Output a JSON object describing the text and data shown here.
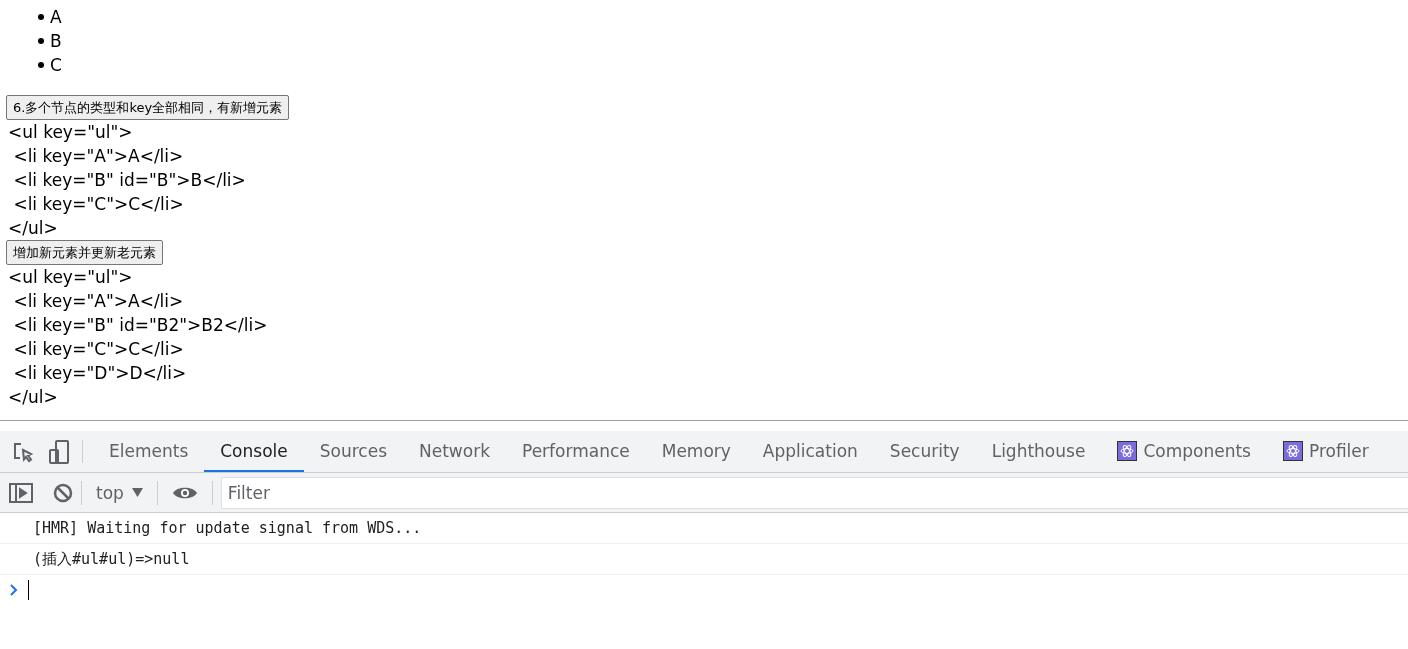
{
  "page": {
    "list": [
      "A",
      "B",
      "C"
    ],
    "sections": [
      {
        "button": "6.多个节点的类型和key全部相同，有新增元素",
        "code": [
          "<ul key=\"ul\">",
          " <li key=\"A\">A</li>",
          " <li key=\"B\" id=\"B\">B</li>",
          " <li key=\"C\">C</li>",
          "</ul>"
        ]
      },
      {
        "button": "增加新元素并更新老元素",
        "code": [
          "<ul key=\"ul\">",
          " <li key=\"A\">A</li>",
          " <li key=\"B\" id=\"B2\">B2</li>",
          " <li key=\"C\">C</li>",
          " <li key=\"D\">D</li>",
          "</ul>"
        ]
      }
    ]
  },
  "devtools": {
    "tabs": [
      {
        "label": "Elements",
        "selected": false,
        "kind": "builtin"
      },
      {
        "label": "Console",
        "selected": true,
        "kind": "builtin"
      },
      {
        "label": "Sources",
        "selected": false,
        "kind": "builtin"
      },
      {
        "label": "Network",
        "selected": false,
        "kind": "builtin"
      },
      {
        "label": "Performance",
        "selected": false,
        "kind": "builtin"
      },
      {
        "label": "Memory",
        "selected": false,
        "kind": "builtin"
      },
      {
        "label": "Application",
        "selected": false,
        "kind": "builtin"
      },
      {
        "label": "Security",
        "selected": false,
        "kind": "builtin"
      },
      {
        "label": "Lighthouse",
        "selected": false,
        "kind": "builtin"
      },
      {
        "label": "Components",
        "selected": false,
        "kind": "extension"
      },
      {
        "label": "Profiler",
        "selected": false,
        "kind": "extension"
      }
    ],
    "toolbar": {
      "context": "top",
      "filter_placeholder": "Filter"
    },
    "console": {
      "messages": [
        "[HMR] Waiting for update signal from WDS...",
        "(插入#ul#ul)=>null"
      ]
    }
  }
}
